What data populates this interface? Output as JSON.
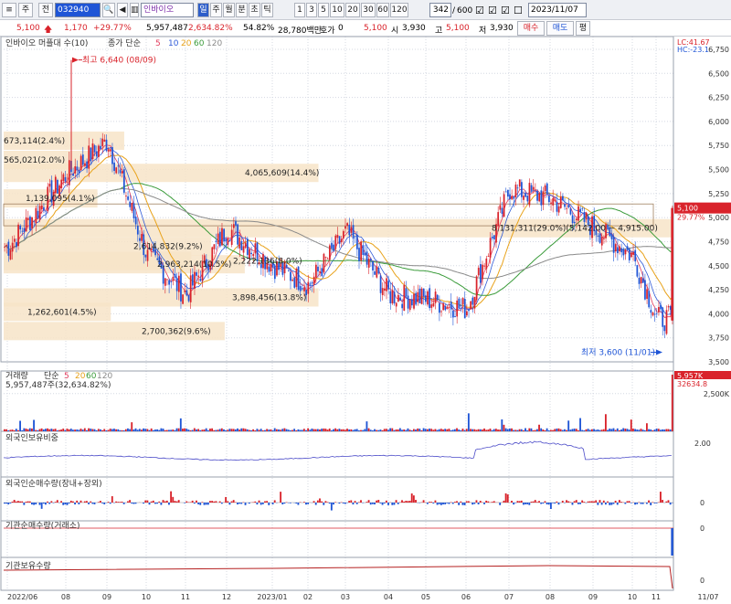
{
  "toolbar": {
    "menu_glyph": "≡",
    "icon_btn_1": "주",
    "icon_btn_2": "전",
    "code": "032940",
    "search_glyph": "🔍",
    "sound_glyph": "◀",
    "sep": "▥",
    "stock_name": "인바이오",
    "period_btns": [
      "일",
      "주",
      "월",
      "분",
      "초",
      "틱"
    ],
    "interval_btns": [
      "1",
      "3",
      "5",
      "10",
      "20",
      "30",
      "60",
      "120"
    ],
    "count": "342",
    "total": "600",
    "check_glyphs": [
      "☑",
      "☑",
      "☑",
      "☐"
    ],
    "date": "2023/11/07"
  },
  "quote": {
    "price": "5,100",
    "price_arrow": "🡅",
    "change": "1,170",
    "change_rate": "+29.77%",
    "volume": "5,957,487",
    "vol_ratio": "2,634.82%",
    "turnover": "54.82%",
    "amount": "28,780백만",
    "hoga_label": "호가",
    "hoga_val": "0",
    "last": "5,100",
    "open_label": "시",
    "open": "3,930",
    "high_label": "고",
    "high": "5,100",
    "low_label": "저",
    "low": "3,930",
    "buy_btn": "매수",
    "sell_btn": "매도",
    "eval_btn": "평"
  },
  "panels": {
    "price_legend": {
      "name": "인바이오 머플대 수(10)",
      "ma_label": "종가 단순",
      "ma_periods": [
        "5",
        "10",
        "20",
        "60",
        "120"
      ],
      "ma_colors": [
        "#e23c5d",
        "#2f5bd8",
        "#e8a21a",
        "#3a9b3a",
        "#8a8a8a"
      ]
    },
    "volume_legend": {
      "name": "거래량",
      "ma_label": "단순",
      "ma_periods": [
        "5",
        "20",
        "60",
        "120"
      ],
      "ma_colors": [
        "#e23c5d",
        "#e8a21a",
        "#3a9b3a",
        "#8a8a8a"
      ],
      "sub": "5,957,487주(32,634.82%)"
    },
    "foreign_ratio": {
      "name": "외국인보유비중"
    },
    "foreign_net": {
      "name": "외국인순매수량(장내+장외)"
    },
    "inst_net": {
      "name": "기관순매수량(거래소)"
    },
    "inst_hold": {
      "name": "기관보유수량"
    },
    "right_top": [
      "LC:41.67",
      "HC:-23.1"
    ]
  },
  "annotations": {
    "high": "최고 6,640 (08/09)",
    "low": "최저 3,600 (11/01)",
    "price_tag": "5,100",
    "price_tag_rate": "29.77%",
    "vol_tag": "5,957K",
    "vol_tag_sub": "32634.8"
  },
  "profile_labels": [
    {
      "level": 5.8,
      "text": "673,114(2.4%)"
    },
    {
      "level": 5.6,
      "text": "565,021(2.0%)"
    },
    {
      "level": 5.2,
      "text": "1,139,095(4.1%)"
    },
    {
      "level": 5.465,
      "text": "4,065,609(14.4%)"
    },
    {
      "level": 4.89,
      "text": "8,131,311(29.0%)(5,142.00 ~ 4,915.00)"
    },
    {
      "level": 4.7,
      "text": "2,614,832(9.2%)"
    },
    {
      "level": 4.515,
      "text": "2,963,214(10.5%)"
    },
    {
      "level": 4.55,
      "text": "2,222,136(8.0%)"
    },
    {
      "level": 4.17,
      "text": "3,898,456(13.8%)"
    },
    {
      "level": 4.02,
      "text": "1,262,601(4.5%)"
    },
    {
      "level": 3.82,
      "text": "2,700,362(9.6%)"
    }
  ],
  "chart_data": {
    "type": "candlestick",
    "title": "인바이오 (032940) 일봉",
    "y_axis_price": {
      "ticks": [
        "6,750",
        "6,500",
        "6,250",
        "6,000",
        "5,750",
        "5,500",
        "5,250",
        "5,000",
        "4,750",
        "4,500",
        "4,250",
        "4,000",
        "3,750",
        "3,500"
      ],
      "ylim": [
        3500,
        6750
      ]
    },
    "y_axis_volume": {
      "ticks": [
        "2,500K"
      ]
    },
    "y_axis_foreign": {
      "ticks": [
        "2.00"
      ]
    },
    "y_axis_zero": {
      "ticks": [
        "0",
        "0",
        "0"
      ]
    },
    "x_axis": {
      "ticks": [
        "2022/06",
        "08",
        "09",
        "10",
        "11",
        "12",
        "2023/01",
        "02",
        "03",
        "04",
        "05",
        "06",
        "07",
        "08",
        "09",
        "10",
        "11",
        "11/07"
      ]
    },
    "price_anchors_month_close": [
      {
        "x": "2022/06",
        "close": 4700
      },
      {
        "x": "2022/07",
        "close": 5450
      },
      {
        "x": "2022/08",
        "close": 5800
      },
      {
        "x": "2022/09",
        "close": 4600
      },
      {
        "x": "2022/10",
        "close": 4200
      },
      {
        "x": "2022/11",
        "close": 4900
      },
      {
        "x": "2022/12",
        "close": 4500
      },
      {
        "x": "2023/01",
        "close": 4300
      },
      {
        "x": "2023/02",
        "close": 4850
      },
      {
        "x": "2023/03",
        "close": 4200
      },
      {
        "x": "2023/04",
        "close": 4150
      },
      {
        "x": "2023/05",
        "close": 4050
      },
      {
        "x": "2023/06",
        "close": 5300
      },
      {
        "x": "2023/07",
        "close": 5200
      },
      {
        "x": "2023/08",
        "close": 4900
      },
      {
        "x": "2023/09",
        "close": 4600
      },
      {
        "x": "2023/10",
        "close": 3950
      },
      {
        "x": "2023/11/07",
        "close": 5100
      }
    ],
    "last_candle": {
      "open": 3930,
      "high": 5100,
      "low": 3930,
      "close": 5100,
      "volume": 5957487
    },
    "extremes": {
      "high": 6640,
      "high_date": "08/09",
      "low": 3600,
      "low_date": "11/01"
    }
  },
  "colors": {
    "up": "#d9232b",
    "down": "#1f55d6",
    "profile_fill": "#f7e4c8",
    "grid": "#d4d8e2",
    "axis_text": "#333333",
    "price_tag": "#d9232b",
    "foreign_line": "#4a4ac8",
    "inst_line": "#b52020"
  }
}
